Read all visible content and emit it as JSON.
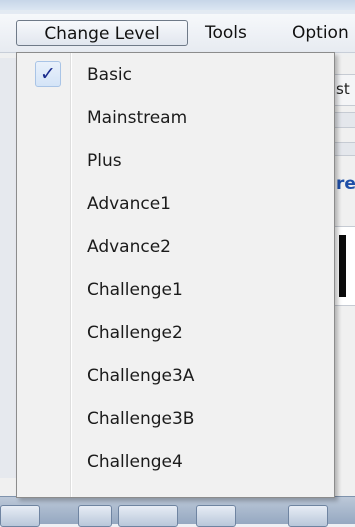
{
  "menubar": {
    "items": [
      {
        "label": "Change Level"
      },
      {
        "label": "Tools"
      },
      {
        "label": "Option"
      }
    ]
  },
  "background": {
    "fragment_text_1": "st",
    "fragment_text_2": "re"
  },
  "dropdown": {
    "check_glyph": "✓",
    "items": [
      {
        "label": "Basic",
        "checked": true
      },
      {
        "label": "Mainstream",
        "checked": false
      },
      {
        "label": "Plus",
        "checked": false
      },
      {
        "label": "Advance1",
        "checked": false
      },
      {
        "label": "Advance2",
        "checked": false
      },
      {
        "label": "Challenge1",
        "checked": false
      },
      {
        "label": "Challenge2",
        "checked": false
      },
      {
        "label": "Challenge3A",
        "checked": false
      },
      {
        "label": "Challenge3B",
        "checked": false
      },
      {
        "label": "Challenge4",
        "checked": false
      }
    ]
  },
  "colors": {
    "check_color": "#1a2b8c",
    "menu_background": "#f1f1f1",
    "highlight_border": "#a9c4e6",
    "background_accent_text": "#1f4fa8"
  }
}
